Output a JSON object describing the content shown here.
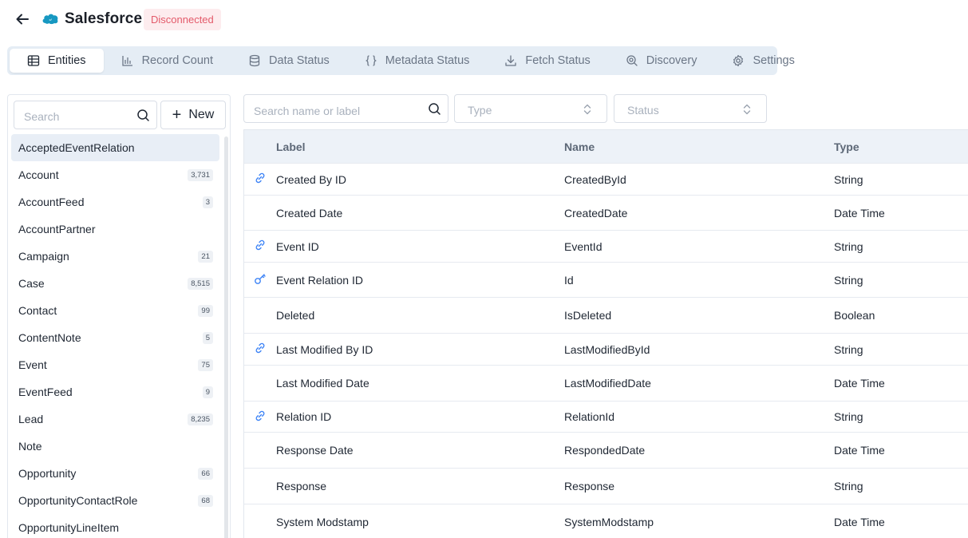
{
  "header": {
    "title": "Salesforce",
    "status": "Disconnected",
    "brand_color": "#1798c1"
  },
  "tabs": [
    {
      "label": "Entities",
      "icon": "table-icon",
      "active": true
    },
    {
      "label": "Record Count",
      "icon": "bar-chart-icon",
      "active": false
    },
    {
      "label": "Data Status",
      "icon": "database-icon",
      "active": false
    },
    {
      "label": "Metadata Status",
      "icon": "braces-icon",
      "active": false
    },
    {
      "label": "Fetch Status",
      "icon": "download-icon",
      "active": false
    },
    {
      "label": "Discovery",
      "icon": "discovery-icon",
      "active": false
    },
    {
      "label": "Settings",
      "icon": "gear-icon",
      "active": false
    }
  ],
  "sidebar": {
    "search_placeholder": "Search",
    "new_label": "New",
    "items": [
      {
        "name": "AcceptedEventRelation",
        "count": "",
        "selected": true
      },
      {
        "name": "Account",
        "count": "3,731"
      },
      {
        "name": "AccountFeed",
        "count": "3"
      },
      {
        "name": "AccountPartner",
        "count": ""
      },
      {
        "name": "Campaign",
        "count": "21"
      },
      {
        "name": "Case",
        "count": "8,515"
      },
      {
        "name": "Contact",
        "count": "99"
      },
      {
        "name": "ContentNote",
        "count": "5"
      },
      {
        "name": "Event",
        "count": "75"
      },
      {
        "name": "EventFeed",
        "count": "9"
      },
      {
        "name": "Lead",
        "count": "8,235"
      },
      {
        "name": "Note",
        "count": ""
      },
      {
        "name": "Opportunity",
        "count": "66"
      },
      {
        "name": "OpportunityContactRole",
        "count": "68"
      },
      {
        "name": "OpportunityLineItem",
        "count": ""
      }
    ]
  },
  "filters": {
    "search_placeholder": "Search name or label",
    "type_placeholder": "Type",
    "status_placeholder": "Status"
  },
  "table": {
    "headers": {
      "label": "Label",
      "name": "Name",
      "type": "Type"
    },
    "rows": [
      {
        "icon": "link-icon",
        "label": "Created By ID",
        "name": "CreatedById",
        "type": "String"
      },
      {
        "icon": "",
        "label": "Created Date",
        "name": "CreatedDate",
        "type": "Date Time"
      },
      {
        "icon": "link-icon",
        "label": "Event ID",
        "name": "EventId",
        "type": "String"
      },
      {
        "icon": "key-icon",
        "label": "Event Relation ID",
        "name": "Id",
        "type": "String"
      },
      {
        "icon": "",
        "label": "Deleted",
        "name": "IsDeleted",
        "type": "Boolean"
      },
      {
        "icon": "link-icon",
        "label": "Last Modified By ID",
        "name": "LastModifiedById",
        "type": "String"
      },
      {
        "icon": "",
        "label": "Last Modified Date",
        "name": "LastModifiedDate",
        "type": "Date Time"
      },
      {
        "icon": "link-icon",
        "label": "Relation ID",
        "name": "RelationId",
        "type": "String"
      },
      {
        "icon": "",
        "label": "Response Date",
        "name": "RespondedDate",
        "type": "Date Time"
      },
      {
        "icon": "",
        "label": "Response",
        "name": "Response",
        "type": "String"
      },
      {
        "icon": "",
        "label": "System Modstamp",
        "name": "SystemModstamp",
        "type": "Date Time"
      }
    ]
  }
}
